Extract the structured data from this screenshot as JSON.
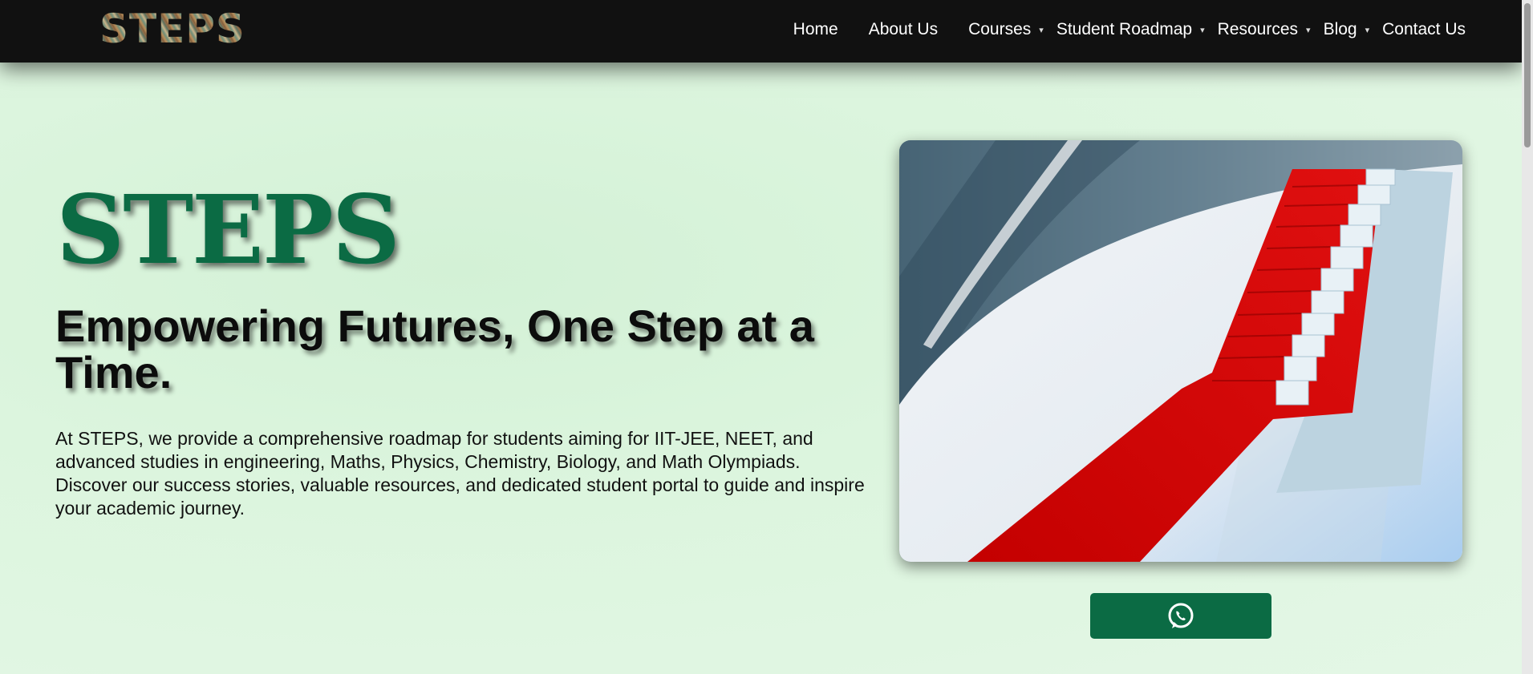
{
  "header": {
    "logo_text": "STEPS",
    "nav": [
      {
        "label": "Home"
      },
      {
        "label": "About Us"
      },
      {
        "label": "Courses"
      },
      {
        "label": "Student Roadmap"
      },
      {
        "label": "Resources"
      },
      {
        "label": "Blog"
      },
      {
        "label": "Contact Us"
      }
    ],
    "caret_icon": "▾"
  },
  "hero": {
    "brand": "STEPS",
    "headline": "Empowering Futures, One Step at a Time.",
    "description": "At STEPS, we provide a comprehensive roadmap for students aiming for IIT-JEE, NEET, and advanced studies in engineering, Maths, Physics, Chemistry, Biology, and Math Olympiads. Discover our success stories, valuable resources, and dedicated student portal to guide and inspire your academic journey.",
    "image": "red-carpet-staircase",
    "whatsapp_icon": "whatsapp-icon"
  },
  "colors": {
    "brand_green": "#0b6b44",
    "navbar_bg": "#111111",
    "carpet_red": "#d40000"
  }
}
